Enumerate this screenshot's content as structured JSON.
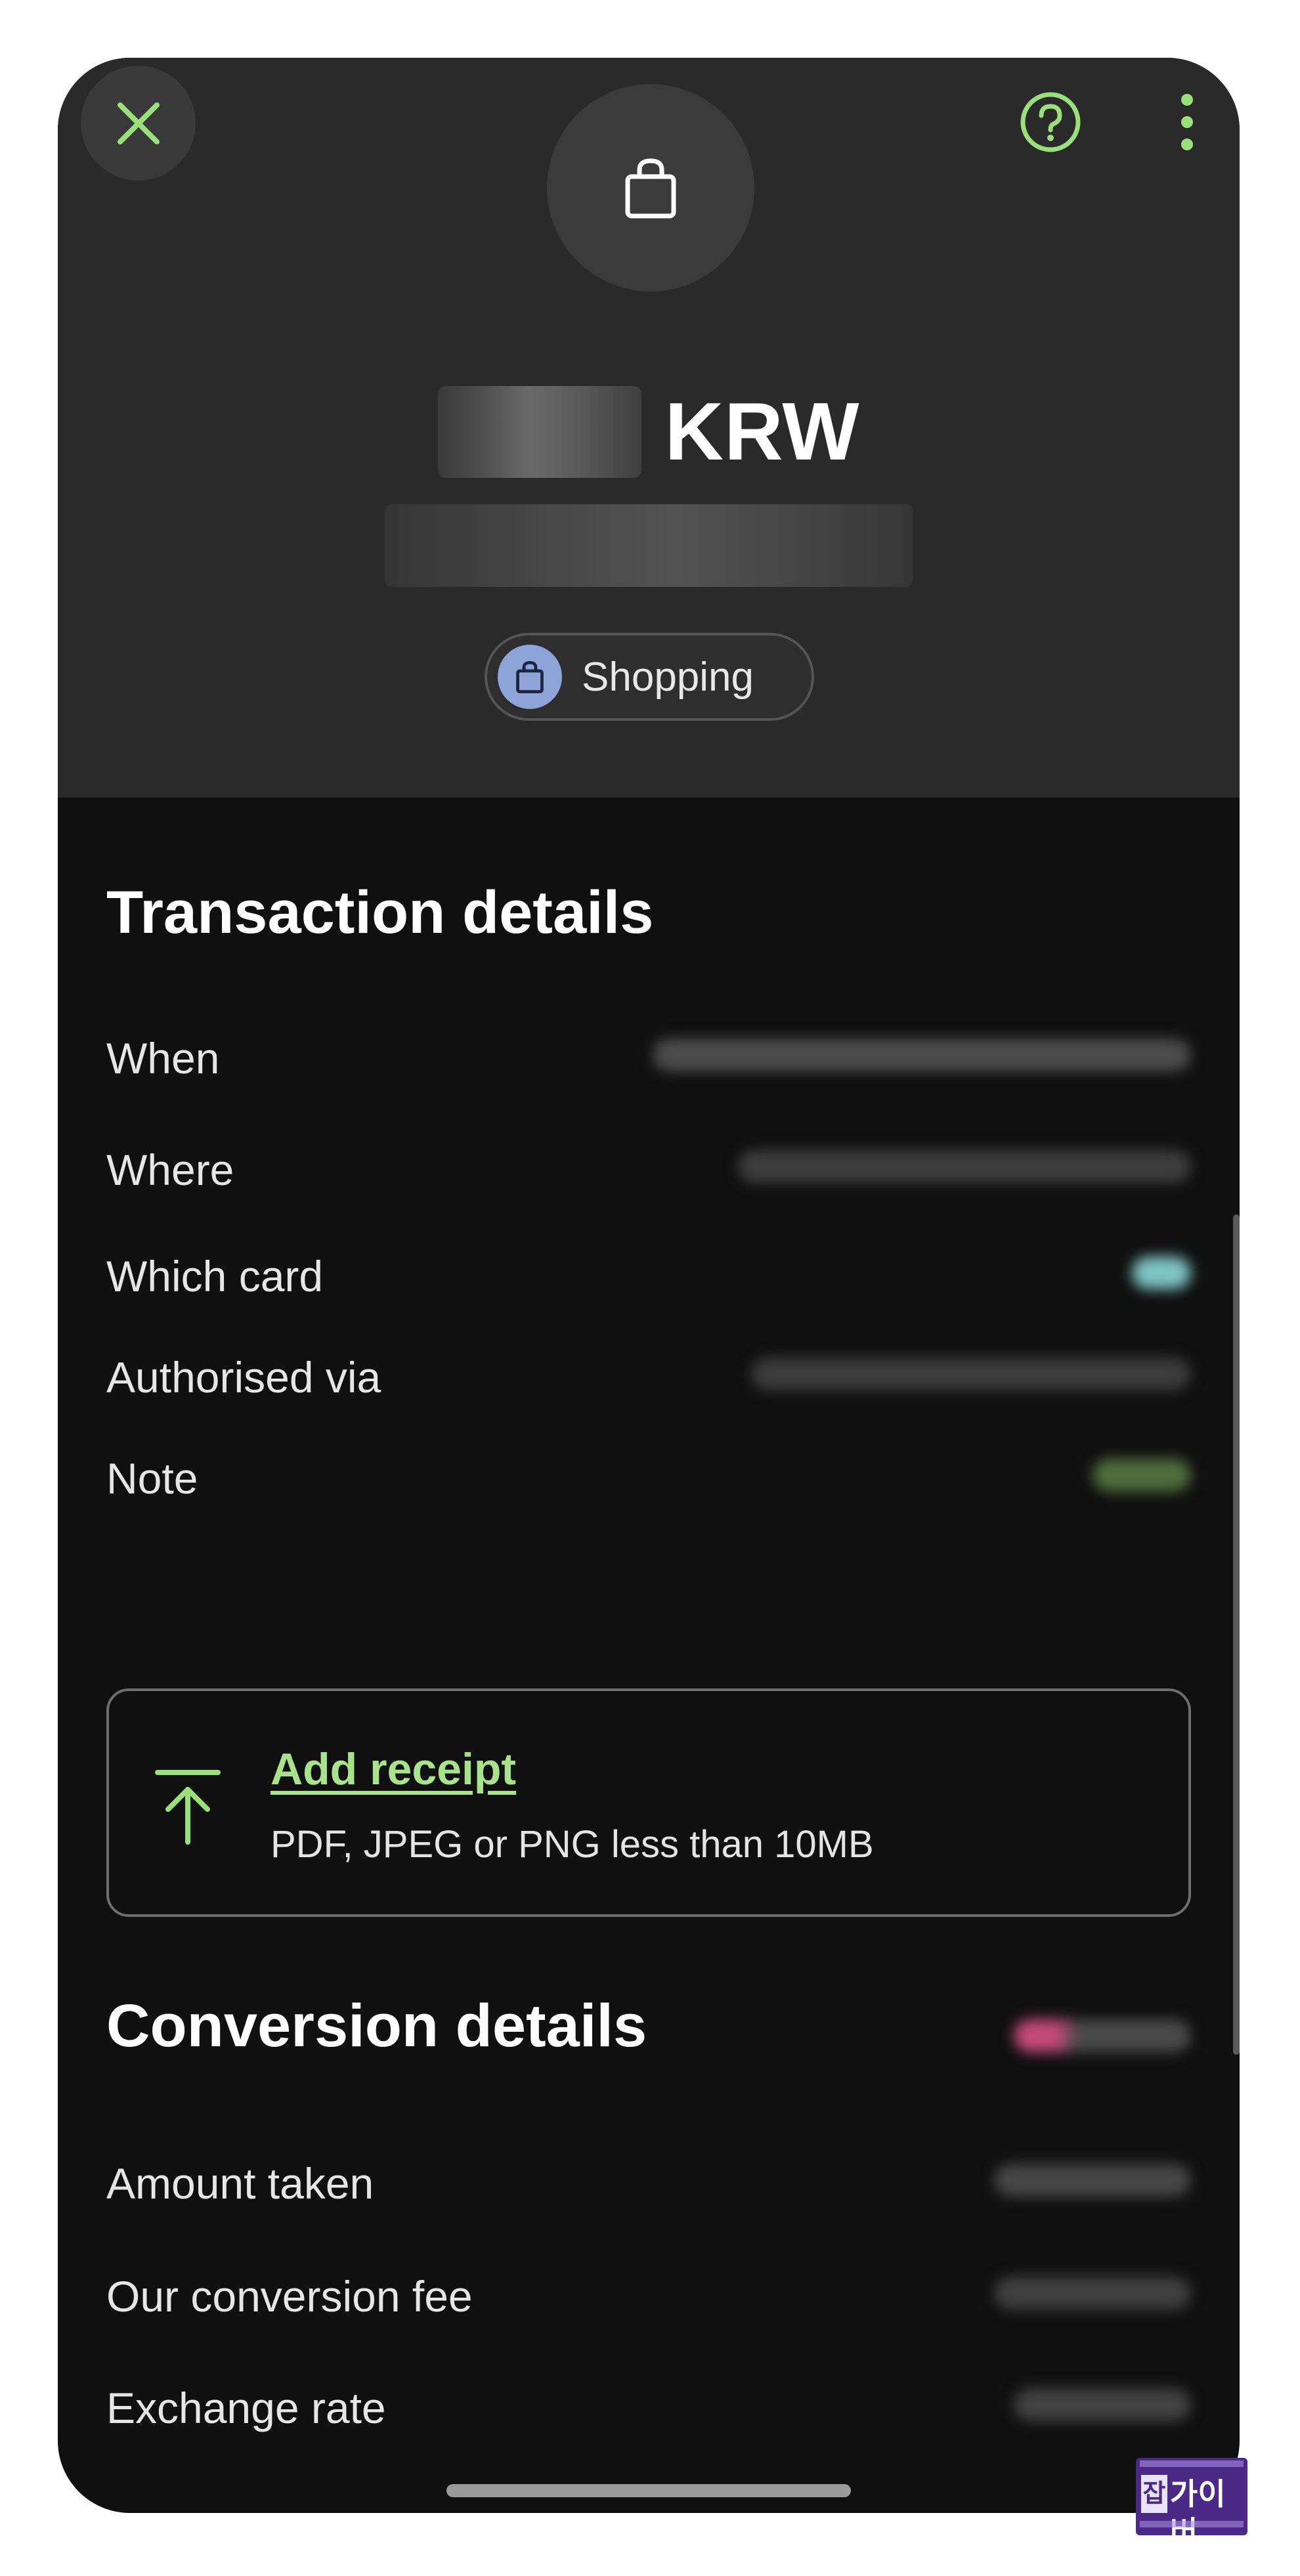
{
  "header": {
    "currency": "KRW",
    "category": "Shopping",
    "icons": {
      "close": "close-icon",
      "help": "help-icon",
      "more": "more-vertical-icon",
      "merchant": "shopping-bag-icon"
    },
    "accent_color": "#9ae07a"
  },
  "transaction": {
    "title": "Transaction details",
    "rows": [
      {
        "label": "When"
      },
      {
        "label": "Where"
      },
      {
        "label": "Which card"
      },
      {
        "label": "Authorised via"
      },
      {
        "label": "Note"
      }
    ]
  },
  "receipt": {
    "title": "Add receipt",
    "subtitle": "PDF, JPEG or PNG less than 10MB",
    "icon": "upload-icon"
  },
  "conversion": {
    "title": "Conversion details",
    "rows": [
      {
        "label": "Amount taken"
      },
      {
        "label": "Our conversion fee"
      },
      {
        "label": "Exchange rate"
      }
    ]
  }
}
